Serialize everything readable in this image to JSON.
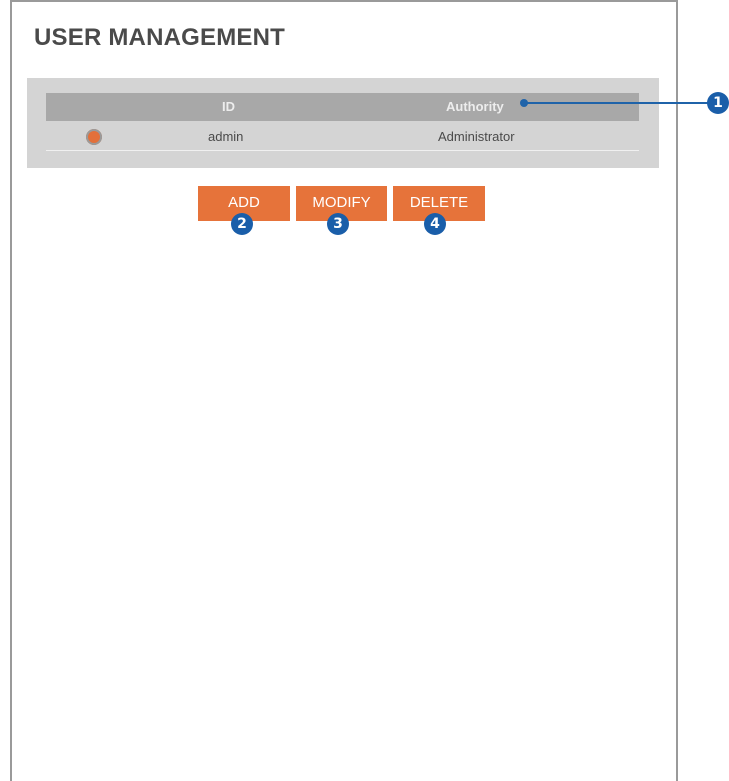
{
  "page": {
    "title": "USER MANAGEMENT"
  },
  "table": {
    "columns": [
      "",
      "ID",
      "Authority"
    ],
    "rows": [
      {
        "selected": true,
        "id": "admin",
        "authority": "Administrator"
      }
    ]
  },
  "buttons": {
    "add": "ADD",
    "modify": "MODIFY",
    "delete": "DELETE"
  },
  "callouts": {
    "one": "1",
    "two": "2",
    "three": "3",
    "four": "4"
  },
  "colors": {
    "accent": "#e6733a",
    "callout": "#1a5ea9",
    "panel": "#d4d4d4",
    "header": "#a8a8a8"
  }
}
